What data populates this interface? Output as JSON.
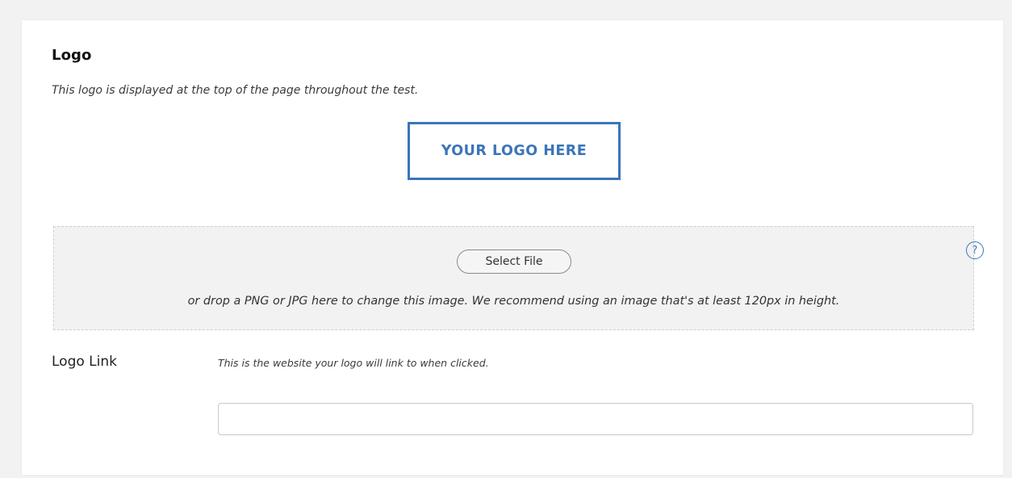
{
  "logo_section": {
    "title": "Logo",
    "description": "This logo is displayed at the top of the page throughout the test.",
    "preview_text": "YOUR LOGO HERE",
    "dropzone": {
      "button_label": "Select File",
      "hint": "or drop a PNG or JPG here to change this image. We recommend using an image that's at least 120px in height.",
      "help_glyph": "?"
    }
  },
  "logo_link": {
    "label": "Logo Link",
    "hint": "This is the website your logo will link to when clicked.",
    "value": "",
    "placeholder": ""
  },
  "colors": {
    "accent": "#3a75b8",
    "background": "#f2f2f2",
    "card": "#ffffff"
  },
  "icons": {
    "help": "question-circle-icon"
  }
}
